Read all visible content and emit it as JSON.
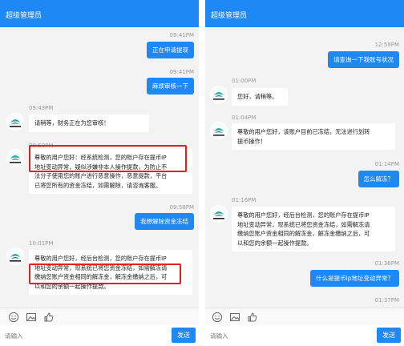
{
  "left": {
    "header_title": "超级管理员",
    "messages": [
      {
        "type": "out",
        "time": "09:41PM",
        "text": "正在申请提现"
      },
      {
        "type": "out",
        "time": "09:41PM",
        "text": "麻烦审核一下"
      },
      {
        "type": "in",
        "time": "09:43PM",
        "lines": [
          "请稍等，财务正在为您审核！"
        ]
      },
      {
        "type": "in",
        "time": "09:50PM",
        "lines": [
          "尊敬的用户您好：经系统检测，您的账户存在提币IP",
          "地址变动异常，疑似涉嫌非本人操作提款，为防止不",
          "法分子使用您的账户进行恶意操作，恶意提款，平台",
          "已将您所有的资金冻结，如需解除，请咨询客服。"
        ]
      },
      {
        "type": "out",
        "time": "09:58PM",
        "text": "我想解除资金冻结"
      },
      {
        "type": "in",
        "time": "10:01PM",
        "lines": [
          "尊敬的用户您好，经后台检测，您的账户存在提币IP",
          "地址变动异常，现系统已将您资金冻结，如需解冻请",
          "缴纳您账户资金相同的解冻金，解冻金缴纳之后，可",
          "以和您的余额一起操作提款。"
        ]
      }
    ],
    "input_placeholder": "请输入",
    "send_label": "发送"
  },
  "right": {
    "header_title": "超级管理员",
    "messages": [
      {
        "type": "out",
        "time": "12:59PM",
        "text": "请查询一下我账号状况"
      },
      {
        "type": "in",
        "time": "01:00PM",
        "lines": [
          "您好，请稍等。"
        ]
      },
      {
        "type": "in",
        "time": "01:04PM",
        "lines": [
          "尊敬的用户您好，该账户目前已冻结，无法进行划转",
          "提币操作！"
        ]
      },
      {
        "type": "out",
        "time": "01:14PM",
        "text": "怎么解冻？"
      },
      {
        "type": "in",
        "time": "01:16PM",
        "lines": [
          "尊敬的用户您好，经后台检测，您的账户存在提币IP",
          "地址变动异常，现系统已将您资金冻结，如需解冻请",
          "缴纳您账户资金相同的解冻金，解冻金缴纳之后，可",
          "以和您的余额一起操作提款。"
        ]
      },
      {
        "type": "out",
        "time": "01:36PM",
        "text": "什么是提币ip地址变动异常？"
      },
      {
        "type": "out",
        "time": "01:37PM",
        "text": ""
      }
    ],
    "input_placeholder": "请输入",
    "send_label": "发送"
  },
  "icons": [
    "smiley-icon",
    "image-icon",
    "thumbs-up-icon"
  ],
  "colors": {
    "accent": "#1e88f5",
    "highlight": "#e02020",
    "background": "#f3f3f3"
  }
}
